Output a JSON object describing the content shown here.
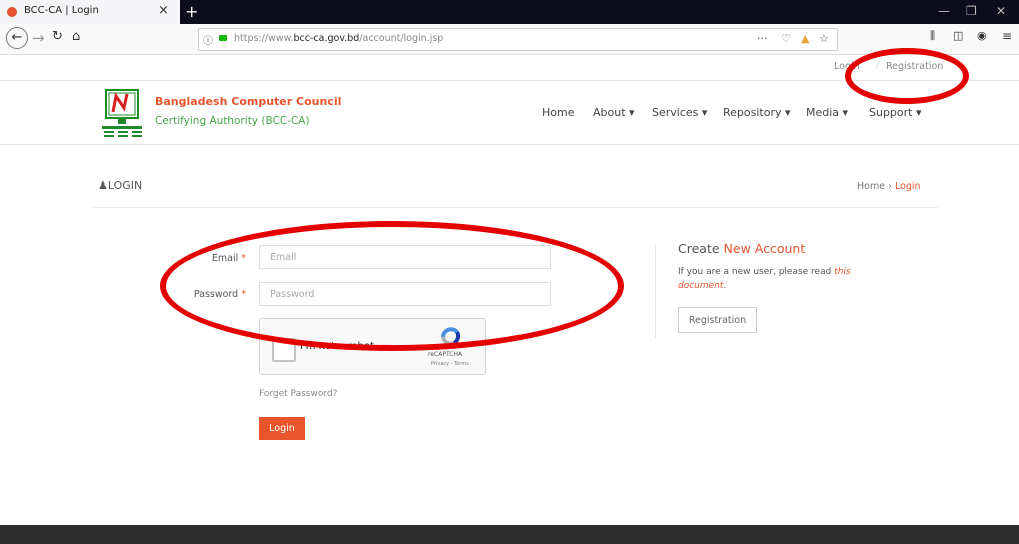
{
  "browser": {
    "tab_title": "BCC-CA | Login",
    "url_scheme": "https://www.",
    "url_domain": "bcc-ca.gov.bd",
    "url_path": "/account/login.jsp"
  },
  "top_links": {
    "login": "Login",
    "registration": "Registration"
  },
  "header": {
    "org_name": "Bangladesh Computer Council",
    "org_sub": "Certifying Authority (BCC-CA)",
    "nav": [
      "Home",
      "About ▾",
      "Services ▾",
      "Repository ▾",
      "Media ▾",
      "Support ▾"
    ]
  },
  "page": {
    "title": "LOGIN",
    "breadcrumb_home": "Home",
    "breadcrumb_sep": "›",
    "breadcrumb_current": "Login"
  },
  "form": {
    "email_label": "Email",
    "email_placeholder": "Email",
    "password_label": "Password",
    "password_placeholder": "Password",
    "required_mark": "*",
    "captcha_text": "I'm not a robot",
    "captcha_brand": "reCAPTCHA",
    "captcha_links": "Privacy - Terms",
    "forgot": "Forget Password?",
    "login_button": "Login"
  },
  "side": {
    "create_prefix": "Create",
    "create_highlight": "New Account",
    "note_text": "If you are a new user, please read",
    "note_link_1": "this",
    "note_link_2": "document",
    "note_end": ".",
    "registration_button": "Registration"
  },
  "colors": {
    "accent": "#e8552c",
    "annotation": "#e50000",
    "sub": "#48a848"
  }
}
